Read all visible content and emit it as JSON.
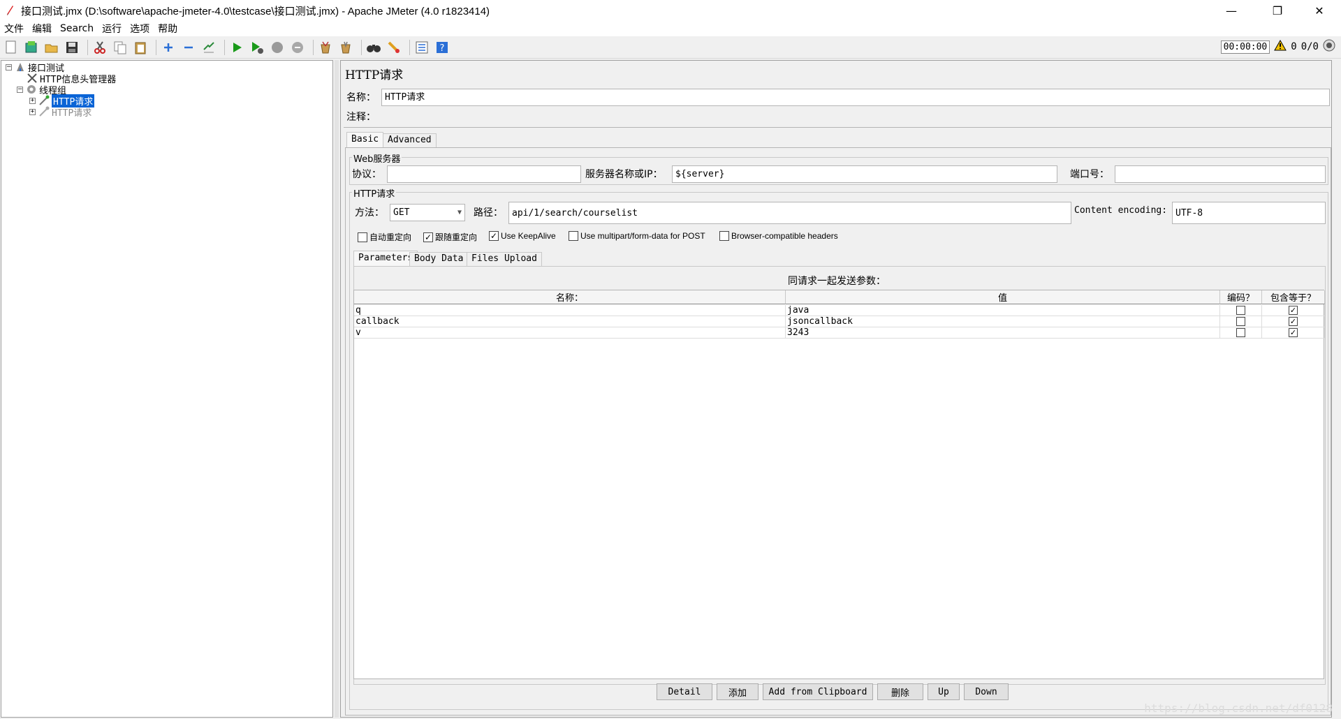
{
  "window": {
    "title": "接口测试.jmx (D:\\software\\apache-jmeter-4.0\\testcase\\接口测试.jmx) - Apache JMeter (4.0 r1823414)",
    "minimize": "—",
    "restore": "❐",
    "close": "✕"
  },
  "menu": [
    "文件",
    "编辑",
    "Search",
    "运行",
    "选项",
    "帮助"
  ],
  "toolbar": {
    "timer": "00:00:00",
    "warning_count": "0",
    "threads": "0/0"
  },
  "tree": {
    "root": "接口测试",
    "header_manager": "HTTP信息头管理器",
    "thread_group": "线程组",
    "http_request_1": "HTTP请求",
    "http_request_2": "HTTP请求"
  },
  "panel": {
    "title": "HTTP请求",
    "name_label": "名称：",
    "name_value": "HTTP请求",
    "comment_label": "注释：",
    "comment_value": "",
    "tabs": [
      "Basic",
      "Advanced"
    ],
    "web_server": {
      "title": "Web服务器",
      "protocol_label": "协议：",
      "protocol_value": "",
      "server_label": "服务器名称或IP：",
      "server_value": "${server}",
      "port_label": "端口号：",
      "port_value": ""
    },
    "http_request": {
      "title": "HTTP请求",
      "method_label": "方法：",
      "method_value": "GET",
      "path_label": "路径：",
      "path_value": "api/1/search/courselist",
      "encoding_label": "Content encoding:",
      "encoding_value": "UTF-8"
    },
    "options": [
      {
        "label": "自动重定向",
        "checked": false
      },
      {
        "label": "跟随重定向",
        "checked": true
      },
      {
        "label": "Use KeepAlive",
        "checked": true
      },
      {
        "label": "Use multipart/form-data for POST",
        "checked": false
      },
      {
        "label": "Browser-compatible headers",
        "checked": false
      }
    ],
    "sub_tabs": [
      "Parameters",
      "Body Data",
      "Files Upload"
    ],
    "params_caption": "同请求一起发送参数：",
    "columns": [
      "名称：",
      "值",
      "编码？",
      "包含等于？"
    ],
    "rows": [
      {
        "name": "q",
        "value": "java",
        "encode": false,
        "include_equals": true
      },
      {
        "name": "callback",
        "value": "jsoncallback",
        "encode": false,
        "include_equals": true
      },
      {
        "name": "v",
        "value": "3243",
        "encode": false,
        "include_equals": true
      }
    ],
    "buttons": {
      "detail": "Detail",
      "add": "添加",
      "add_clipboard": "Add from Clipboard",
      "delete": "删除",
      "up": "Up",
      "down": "Down"
    }
  },
  "watermark": "https://blog.csdn.net/df0128",
  "colors": {
    "selection": "#0a64d6",
    "run_green": "#1a9a1a",
    "accent_blue": "#2b6fd6"
  }
}
